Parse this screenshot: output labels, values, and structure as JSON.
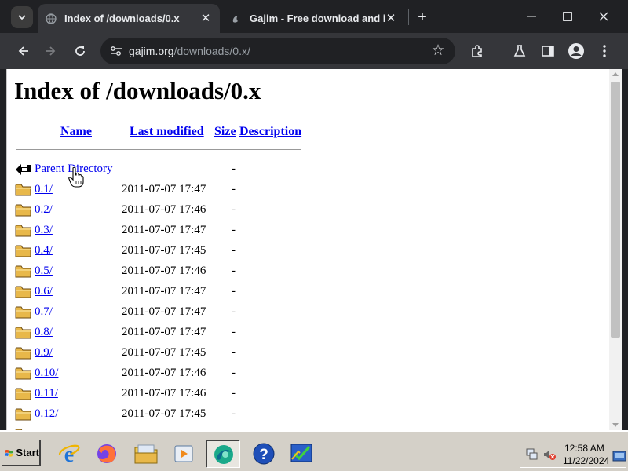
{
  "browser": {
    "tab_search_icon": "chevron-down-icon",
    "tabs": [
      {
        "title": "Index of /downloads/0.x",
        "active": true
      },
      {
        "title": "Gajim - Free download and ins",
        "active": false
      }
    ],
    "url_domain": "gajim.org",
    "url_path": "/downloads/0.x/"
  },
  "page": {
    "title": "Index of /downloads/0.x",
    "columns": {
      "name": "Name",
      "last_modified": "Last modified",
      "size": "Size",
      "description": "Description"
    },
    "entries": [
      {
        "name": "Parent Directory",
        "date": "",
        "size": "-",
        "icon": "back-icon"
      },
      {
        "name": "0.1/",
        "date": "2011-07-07 17:47",
        "size": "-",
        "icon": "folder-icon"
      },
      {
        "name": "0.2/",
        "date": "2011-07-07 17:46",
        "size": "-",
        "icon": "folder-icon"
      },
      {
        "name": "0.3/",
        "date": "2011-07-07 17:47",
        "size": "-",
        "icon": "folder-icon"
      },
      {
        "name": "0.4/",
        "date": "2011-07-07 17:45",
        "size": "-",
        "icon": "folder-icon"
      },
      {
        "name": "0.5/",
        "date": "2011-07-07 17:46",
        "size": "-",
        "icon": "folder-icon"
      },
      {
        "name": "0.6/",
        "date": "2011-07-07 17:47",
        "size": "-",
        "icon": "folder-icon"
      },
      {
        "name": "0.7/",
        "date": "2011-07-07 17:47",
        "size": "-",
        "icon": "folder-icon"
      },
      {
        "name": "0.8/",
        "date": "2011-07-07 17:47",
        "size": "-",
        "icon": "folder-icon"
      },
      {
        "name": "0.9/",
        "date": "2011-07-07 17:45",
        "size": "-",
        "icon": "folder-icon"
      },
      {
        "name": "0.10/",
        "date": "2011-07-07 17:46",
        "size": "-",
        "icon": "folder-icon"
      },
      {
        "name": "0.11/",
        "date": "2011-07-07 17:46",
        "size": "-",
        "icon": "folder-icon"
      },
      {
        "name": "0.12/",
        "date": "2011-07-07 17:45",
        "size": "-",
        "icon": "folder-icon"
      }
    ]
  },
  "taskbar": {
    "start_label": "Start",
    "clock_time": "12:58 AM",
    "clock_date": "11/22/2024"
  },
  "colors": {
    "link": "#0000ee",
    "chrome_dark": "#202124",
    "chrome_toolbar": "#35363a",
    "taskbar": "#d4d0c8",
    "folder": "#e8b84a"
  }
}
